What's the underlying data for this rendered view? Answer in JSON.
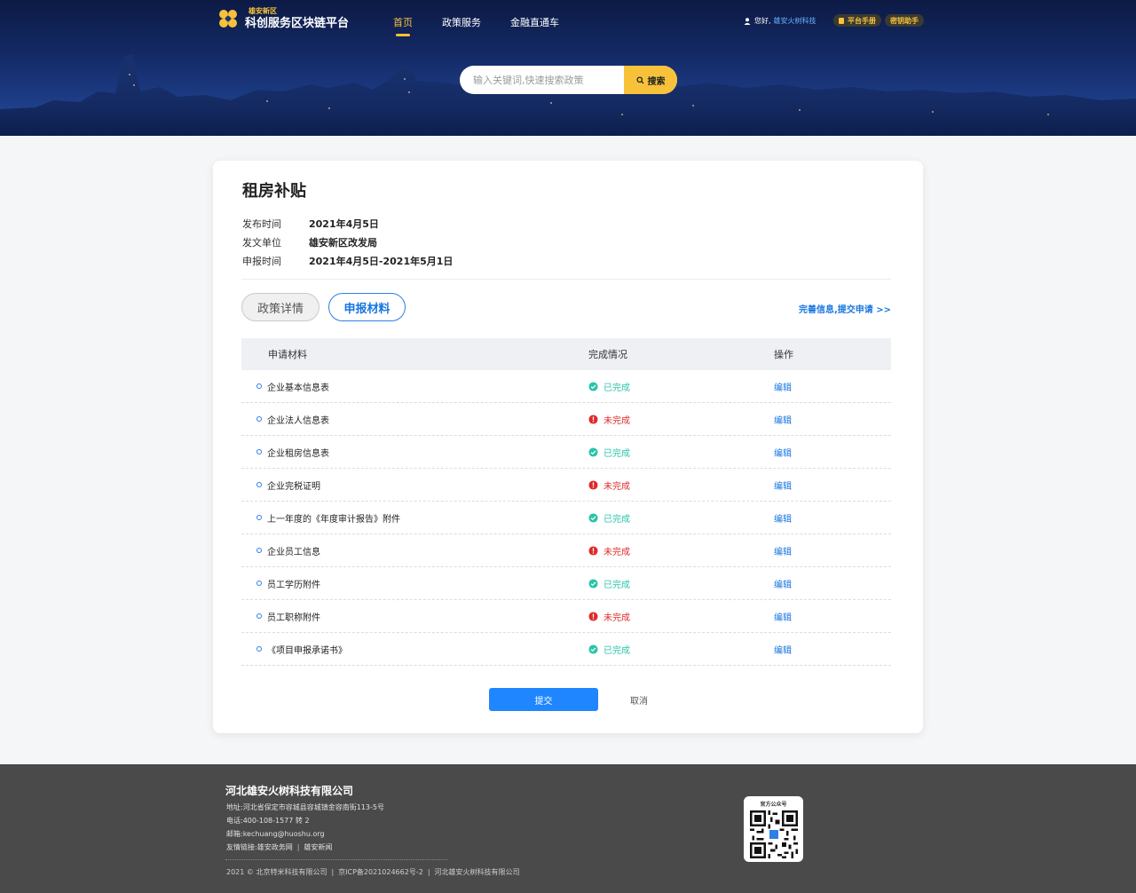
{
  "header": {
    "logo_sub": "雄安新区",
    "logo_main": "科创服务区块链平台",
    "nav": [
      {
        "label": "首页",
        "active": true
      },
      {
        "label": "政策服务",
        "active": false
      },
      {
        "label": "金融直通车",
        "active": false
      }
    ],
    "greeting": "您好,",
    "username": "雄安火树科技",
    "manual_label": "平台手册",
    "key_label": "密钥助手",
    "search_placeholder": "输入关键词,快速搜索政策",
    "search_button": "搜索"
  },
  "policy": {
    "title": "租房补贴",
    "meta": [
      {
        "key": "发布时间",
        "value": "2021年4月5日"
      },
      {
        "key": "发文单位",
        "value": "雄安新区改发局"
      },
      {
        "key": "申报时间",
        "value": "2021年4月5日-2021年5月1日"
      }
    ],
    "tabs": [
      {
        "label": "政策详情",
        "active": false
      },
      {
        "label": "申报材料",
        "active": true
      }
    ],
    "complete_link": "完善信息,提交申请 >>"
  },
  "table": {
    "headers": {
      "material": "申请材料",
      "status": "完成情况",
      "op": "操作"
    },
    "rows": [
      {
        "material": "企业基本信息表",
        "status": "已完成",
        "done": true,
        "op": "编辑"
      },
      {
        "material": "企业法人信息表",
        "status": "未完成",
        "done": false,
        "op": "编辑"
      },
      {
        "material": "企业租房信息表",
        "status": "已完成",
        "done": true,
        "op": "编辑"
      },
      {
        "material": "企业完税证明",
        "status": "未完成",
        "done": false,
        "op": "编辑"
      },
      {
        "material": "上一年度的《年度审计报告》附件",
        "status": "已完成",
        "done": true,
        "op": "编辑"
      },
      {
        "material": "企业员工信息",
        "status": "未完成",
        "done": false,
        "op": "编辑"
      },
      {
        "material": "员工学历附件",
        "status": "已完成",
        "done": true,
        "op": "编辑"
      },
      {
        "material": "员工职称附件",
        "status": "未完成",
        "done": false,
        "op": "编辑"
      },
      {
        "material": "《项目申报承诺书》",
        "status": "已完成",
        "done": true,
        "op": "编辑"
      }
    ]
  },
  "actions": {
    "submit": "提交",
    "cancel": "取消"
  },
  "footer": {
    "company": "河北雄安火树科技有限公司",
    "address": "地址:河北省保定市容城县容城镇金容南街113-5号",
    "phone": "电话:400-108-1577 转 2",
    "email": "邮箱:kechuang@huoshu.org",
    "links_label": "友情链接:",
    "links": [
      "雄安政务网",
      "雄安新闻"
    ],
    "copyright": [
      "2021 © 北京特米科技有限公司",
      "京ICP备2021024662号-2",
      "河北雄安火树科技有限公司"
    ],
    "qr_label": "官方公众号"
  },
  "colors": {
    "accent": "#f7c23a",
    "primary": "#1f86ff",
    "done": "#2bc4a8",
    "todo": "#e02a2a",
    "footer_bg": "#4a4a4a"
  }
}
